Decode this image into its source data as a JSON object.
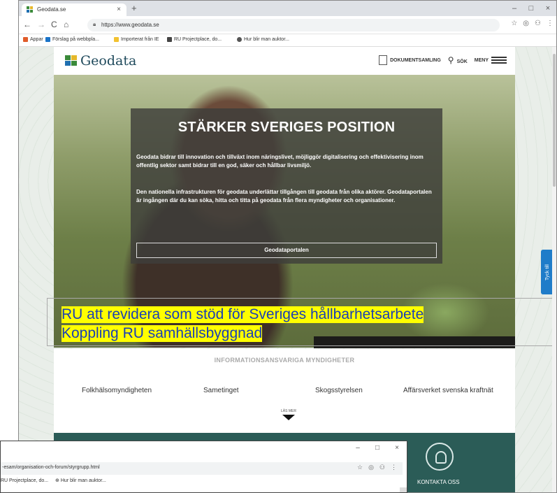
{
  "browser": {
    "tab_title": "Geodata.se",
    "tab_close": "×",
    "new_tab": "+",
    "url": "https://www.geodata.se",
    "window_controls": [
      "–",
      "□",
      "×"
    ],
    "bookmarks": [
      {
        "label": "Appar",
        "color": "#e05c2a"
      },
      {
        "label": "Förslag på webbpla...",
        "color": "#1a73c8"
      },
      {
        "label": "Importerat från IE",
        "color": "#f2c230"
      },
      {
        "label": "RU Projectplace, do...",
        "color": "#444444"
      },
      {
        "label": "Hur blir man auktor...",
        "color": "#555555"
      }
    ]
  },
  "site": {
    "logo_text": "Geodata",
    "nav": {
      "documents": "DOKUMENTSAMLING",
      "search": "SÖK",
      "menu": "MENY"
    },
    "hero": {
      "title": "STÄRKER SVERIGES POSITION",
      "paragraph1": "Geodata bidrar till innovation och tillväxt inom näringslivet, möjliggör digitalisering och effektivisering inom offentlig sektor samt bidrar till en god, säker och hållbar livsmiljö.",
      "paragraph2": "Den nationella infrastrukturen för geodata underlättar tillgången till geodata från olika aktörer. Geodataportalen är ingången där du kan söka, hitta och titta på geodata från flera myndigheter och organisationer.",
      "button": "Geodataportalen"
    },
    "feedback_tab": "Tyck till",
    "info_heading": "INFORMATIONSANSVARIGA MYNDIGHETER",
    "agencies": [
      "Folkhälsomyndigheten",
      "Sametinget",
      "Skogsstyrelsen",
      "Affärsverket svenska kraftnät"
    ],
    "read_more": "LÄS MER",
    "contact": "KONTAKTA OSS"
  },
  "annotation": {
    "line1": "RU att revidera som stöd för Sveriges hållbarhetsarbete",
    "line2": "Koppling RU samhällsbyggnad",
    "highlight_color": "#ffff00",
    "text_color": "#1a3fb5"
  },
  "second_window": {
    "url": "-esam/organisation-och-forum/styrgrupp.html",
    "bookmarks_text": "RU Projectplace, do...",
    "bookmarks_text2": "Hur blir man auktor...",
    "window_controls": [
      "–",
      "□",
      "×"
    ]
  }
}
